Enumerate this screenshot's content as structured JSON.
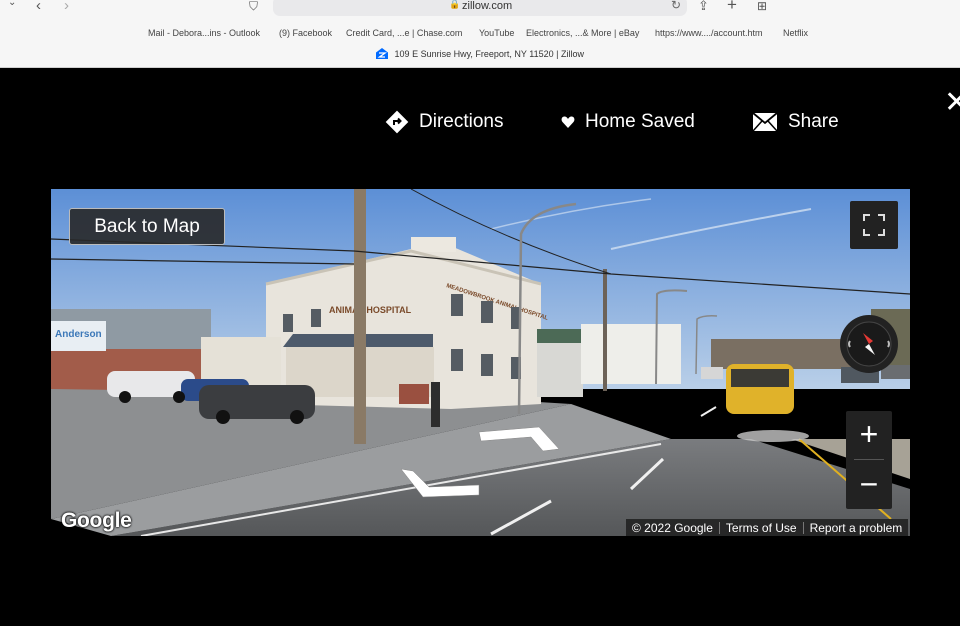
{
  "browser": {
    "url": "zillow.com",
    "bookmarks": [
      "Mail - Debora...ins - Outlook",
      "(9) Facebook",
      "Credit Card, ...e | Chase.com",
      "YouTube",
      "Electronics, ...& More | eBay",
      "https://www..../account.htm",
      "Netflix"
    ],
    "tab_title": "109 E Sunrise Hwy, Freeport, NY 11520 | Zillow"
  },
  "actions": {
    "directions": "Directions",
    "home_saved": "Home Saved",
    "share": "Share"
  },
  "streetview": {
    "back_to_map": "Back to Map",
    "google_logo": "Google",
    "copyright": "© 2022 Google",
    "terms": "Terms of Use",
    "report": "Report a problem",
    "zoom_in": "+",
    "zoom_out": "−",
    "signs": {
      "building": "ANIMAL HOSPITAL",
      "building_top": "MEADOWBROOK ANIMAL HOSPITAL",
      "left_sign": "Anderson"
    }
  },
  "colors": {
    "overlay_bg": "#000000",
    "zillow_blue": "#006aff"
  }
}
